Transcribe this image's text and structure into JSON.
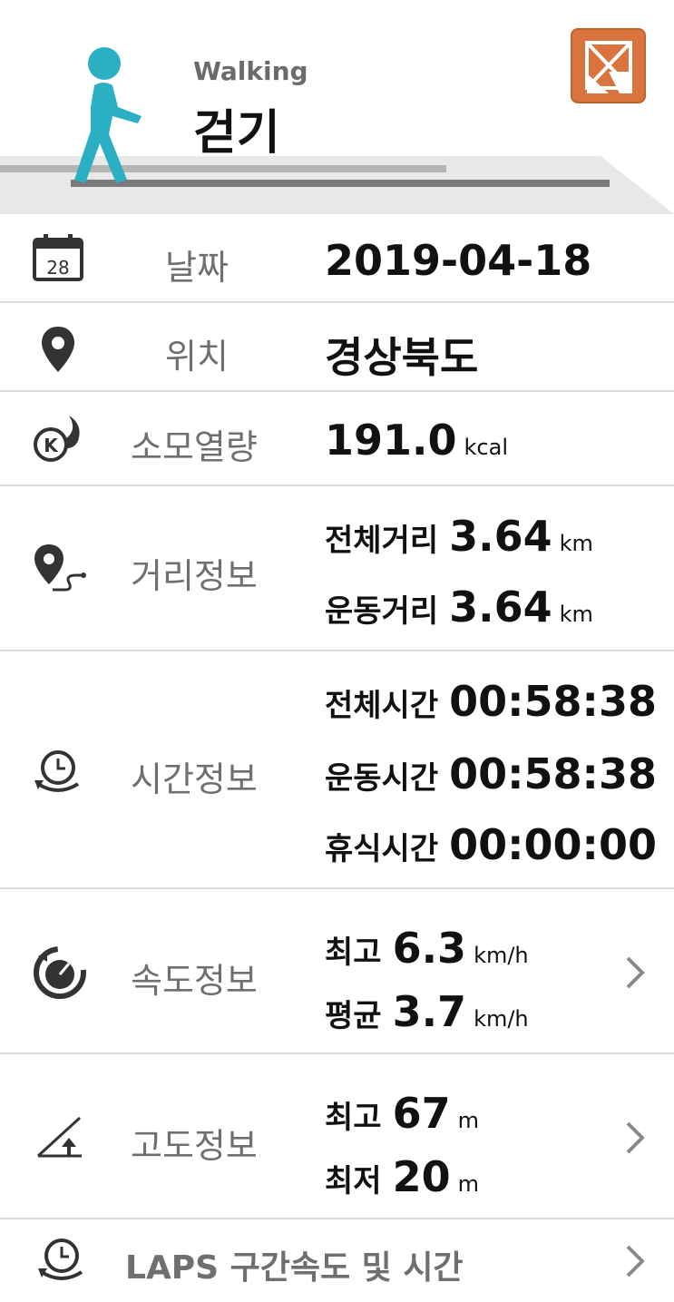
{
  "header": {
    "subtitle": "Walking",
    "title": "걷기",
    "share_icon": "share-icon",
    "walker_icon": "walking-person-icon",
    "accent_color": "#2ab0c2",
    "share_color": "#d9743e"
  },
  "date": {
    "label": "날짜",
    "value": "2019-04-18",
    "icon": "calendar-icon",
    "icon_text": "28"
  },
  "location": {
    "label": "위치",
    "value": "경상북도",
    "icon": "map-pin-icon"
  },
  "calories": {
    "label": "소모열량",
    "value": "191.0",
    "unit": "kcal",
    "icon": "calorie-icon"
  },
  "distance": {
    "label": "거리정보",
    "icon": "route-icon",
    "total_label": "전체거리",
    "total_value": "3.64",
    "total_unit": "km",
    "exercise_label": "운동거리",
    "exercise_value": "3.64",
    "exercise_unit": "km"
  },
  "time": {
    "label": "시간정보",
    "icon": "clock-icon",
    "total_label": "전체시간",
    "total_value": "00:58:38",
    "exercise_label": "운동시간",
    "exercise_value": "00:58:38",
    "rest_label": "휴식시간",
    "rest_value": "00:00:00"
  },
  "speed": {
    "label": "속도정보",
    "icon": "speedometer-icon",
    "max_label": "최고",
    "max_value": "6.3",
    "max_unit": "km/h",
    "avg_label": "평균",
    "avg_value": "3.7",
    "avg_unit": "km/h"
  },
  "altitude": {
    "label": "고도정보",
    "icon": "altitude-icon",
    "max_label": "최고",
    "max_value": "67",
    "max_unit": "m",
    "min_label": "최저",
    "min_value": "20",
    "min_unit": "m"
  },
  "laps": {
    "label": "LAPS 구간속도 및 시간",
    "icon": "laps-clock-icon"
  }
}
